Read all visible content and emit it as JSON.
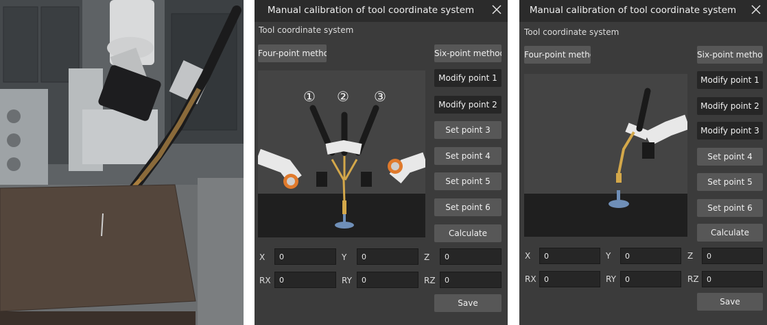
{
  "dialog": {
    "title": "Manual calibration of tool coordinate system",
    "subtitle": "Tool coordinate system",
    "four_point_label": "Four-point method",
    "six_point_label": "Six-point method",
    "calculate_label": "Calculate",
    "save_label": "Save"
  },
  "panel_left": {
    "points": [
      "Modify point 1",
      "Modify point 2",
      "Set point 3",
      "Set point 4",
      "Set point 5",
      "Set point 6"
    ],
    "illustration_markers": [
      "①",
      "②",
      "③"
    ],
    "fields": {
      "x_label": "X",
      "x_value": "0",
      "y_label": "Y",
      "y_value": "0",
      "z_label": "Z",
      "z_value": "0",
      "rx_label": "RX",
      "rx_value": "0",
      "ry_label": "RY",
      "ry_value": "0",
      "rz_label": "RZ",
      "rz_value": "0"
    }
  },
  "panel_right": {
    "points": [
      "Modify point 1",
      "Modify point 2",
      "Modify point 3",
      "Set point 4",
      "Set point 5",
      "Set point 6"
    ],
    "fields": {
      "x_label": "X",
      "x_value": "0",
      "y_label": "Y",
      "y_value": "0",
      "z_label": "Z",
      "z_value": "0",
      "rx_label": "RX",
      "rx_value": "0",
      "ry_label": "RY",
      "ry_value": "0",
      "rz_label": "RZ",
      "rz_value": "0"
    }
  },
  "colors": {
    "panel_bg": "#3b3b3b",
    "titlebar_bg": "#2b2b2b",
    "button_bg": "#575757",
    "button_modified_bg": "#262626",
    "field_bg": "#262626",
    "robot_accent": "#e07a2c",
    "torch_yellow": "#d4a84a",
    "target_blue": "#6f8fb8"
  },
  "icons": [
    "close-icon"
  ]
}
